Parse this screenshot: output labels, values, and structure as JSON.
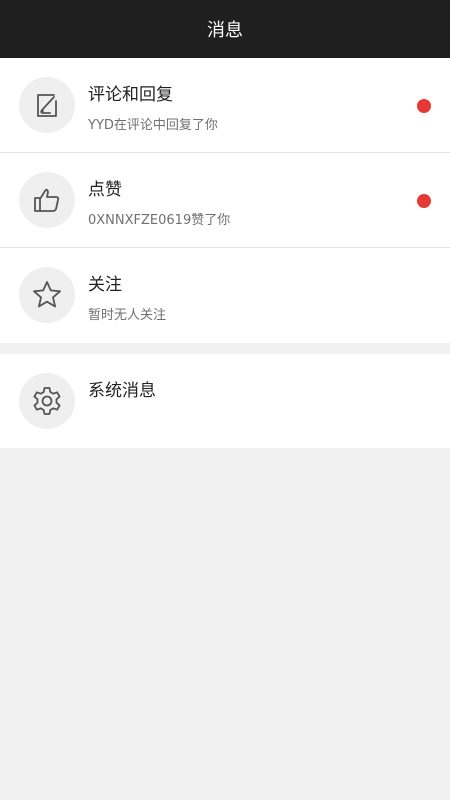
{
  "header": {
    "title": "消息"
  },
  "messages": [
    {
      "icon": "edit-document-icon",
      "title": "评论和回复",
      "subtitle": "YYD在评论中回复了你",
      "unread": true
    },
    {
      "icon": "thumbs-up-icon",
      "title": "点赞",
      "subtitle": "0XNNXFZE0619赞了你",
      "unread": true
    },
    {
      "icon": "star-icon",
      "title": "关注",
      "subtitle": "暂时无人关注",
      "unread": false
    }
  ],
  "system": {
    "icon": "gear-icon",
    "title": "系统消息"
  },
  "colors": {
    "header_bg": "#1f1f1f",
    "unread_dot": "#e53935",
    "page_bg": "#f1f1f1"
  }
}
